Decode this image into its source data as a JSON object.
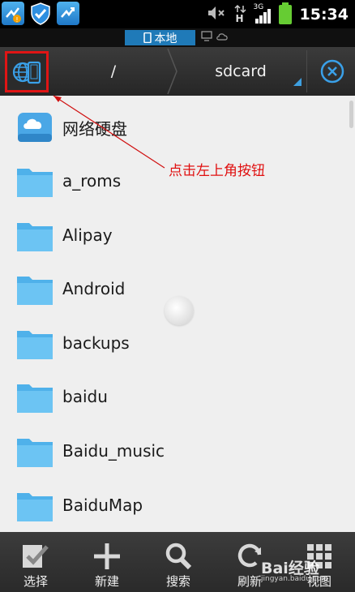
{
  "status_bar": {
    "time": "15:34",
    "network": "3G",
    "network_sub": "H",
    "icons": [
      "sync-warning-icon",
      "shield-icon",
      "sync-icon",
      "mute-icon",
      "data-icon",
      "signal-icon",
      "battery-icon"
    ]
  },
  "location_tabs": {
    "local_label": "本地"
  },
  "path": {
    "root": "/",
    "current": "sdcard"
  },
  "annotation": {
    "text": "点击左上角按钮",
    "color": "#e01010"
  },
  "files": [
    {
      "name": "网络硬盘",
      "icon": "cloud-drive-icon"
    },
    {
      "name": "a_roms",
      "icon": "folder-icon"
    },
    {
      "name": "Alipay",
      "icon": "folder-icon"
    },
    {
      "name": "Android",
      "icon": "folder-icon"
    },
    {
      "name": "backups",
      "icon": "folder-icon"
    },
    {
      "name": "baidu",
      "icon": "folder-icon"
    },
    {
      "name": "Baidu_music",
      "icon": "folder-icon"
    },
    {
      "name": "BaiduMap",
      "icon": "folder-icon"
    }
  ],
  "toolbar": {
    "select_label": "选择",
    "new_label": "新建",
    "search_label": "搜索",
    "refresh_label": "刷新",
    "view_label": "视图"
  },
  "watermark": {
    "brand": "Bai经验",
    "sub": "jingyan.baidu.com"
  },
  "colors": {
    "accent": "#1f7ab8",
    "folder": "#5bbbee",
    "highlight_border": "#e01515"
  }
}
